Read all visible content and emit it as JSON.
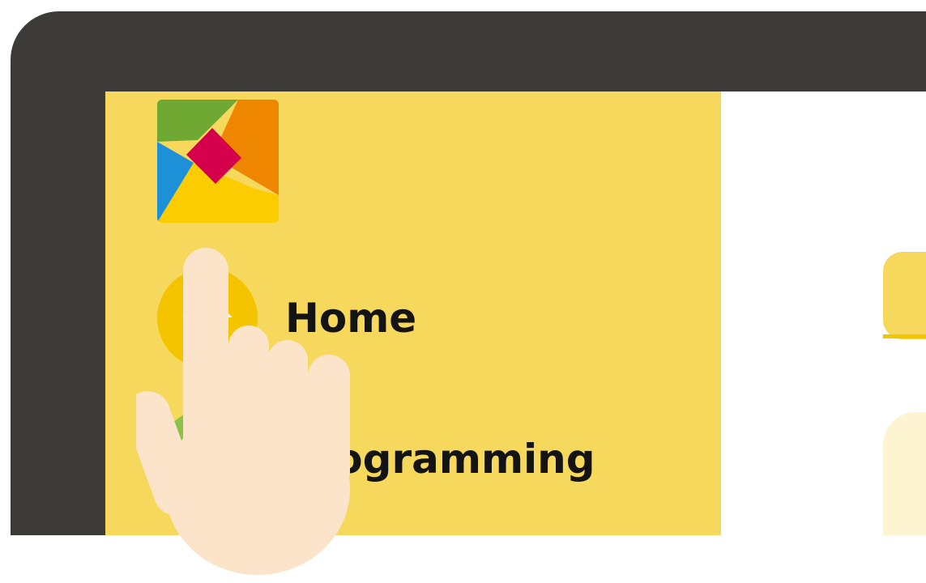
{
  "sidebar": {
    "logo_icon": "tangram-logo-icon",
    "items": [
      {
        "label": "Home",
        "icon": "home-icon"
      },
      {
        "label": "Programming",
        "icon": "code-icon"
      }
    ]
  },
  "colors": {
    "sidebar_bg": "#f6d85c",
    "device_bezel": "#3c3b39",
    "accent_yellow": "#f5c400",
    "accent_pale": "#fdf5d2"
  },
  "overlay": {
    "icon": "pointing-hand-icon"
  }
}
